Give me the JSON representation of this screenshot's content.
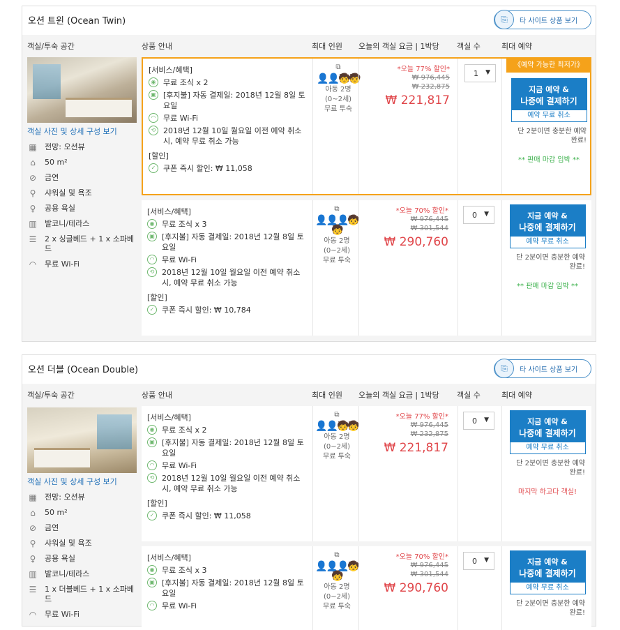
{
  "headers": {
    "room": "객실/투숙 공간",
    "product": "상품 안내",
    "occ": "최대 인원",
    "price": "오늘의 객실 요금 | 1박당",
    "qty": "객실 수",
    "book": "최대 예약"
  },
  "other_site": "타 사이트 상품 보기",
  "photo_link": "객실 사진 및 상세 구성 보기",
  "svc_head": "[서비스/혜택]",
  "disc_head": "[할인]",
  "occ_child": "아동 2명",
  "occ_age": "(0~2세)",
  "occ_free": "무료 투숙",
  "book_line1": "지금 예약 &",
  "book_line2": "나중에 결제하기",
  "free_cancel": "예약 무료 취소",
  "note": "단 2분이면 충분한 예약 완료!",
  "best_badge": "《예약 가능한 최저가》",
  "rooms": [
    {
      "title": "오션 트윈 (Ocean Twin)",
      "features": [
        "전망: 오션뷰",
        "50 m²",
        "금연",
        "샤워실 및 욕조",
        "공용 욕실",
        "발코니/테라스",
        "2 x 싱글베드 + 1 x 소파베드",
        "무료 Wi-Fi"
      ],
      "offers": [
        {
          "breakfast": "무료 조식 x 2",
          "pay": "[후지불] 자동 결제일: 2018년 12월 8일 토요일",
          "wifi": "무료 Wi-Fi",
          "cancel": "2018년 12월 10일 월요일 이전 예약 취소 시, 예약 무료 취소 가능",
          "coupon": "쿠폰 즉시 할인: ₩ 11,058",
          "disc": "*오늘 77% 할인*",
          "orig1": "₩ 976,445",
          "orig2": "₩ 232,875",
          "now": "₩ 221,817",
          "qty": "1",
          "alert": "** 판매 마감 임박 **",
          "alert_type": "green"
        },
        {
          "breakfast": "무료 조식 x 3",
          "pay": "[후지불] 자동 결제일: 2018년 12월 8일 토요일",
          "wifi": "무료 Wi-Fi",
          "cancel": "2018년 12월 10일 월요일 이전 예약 취소 시, 예약 무료 취소 가능",
          "coupon": "쿠폰 즉시 할인: ₩ 10,784",
          "disc": "*오늘 70% 할인*",
          "orig1": "₩ 976,445",
          "orig2": "₩ 301,544",
          "now": "₩ 290,760",
          "qty": "0",
          "alert": "** 판매 마감 임박 **",
          "alert_type": "green"
        }
      ]
    },
    {
      "title": "오션 더블 (Ocean Double)",
      "features": [
        "전망: 오션뷰",
        "50 m²",
        "금연",
        "샤워실 및 욕조",
        "공용 욕실",
        "발코니/테라스",
        "1 x 더블베드 + 1 x 소파베드",
        "무료 Wi-Fi"
      ],
      "offers": [
        {
          "breakfast": "무료 조식 x 2",
          "pay": "[후지불] 자동 결제일: 2018년 12월 8일 토요일",
          "wifi": "무료 Wi-Fi",
          "cancel": "2018년 12월 10일 월요일 이전 예약 취소 시, 예약 무료 취소 가능",
          "coupon": "쿠폰 즉시 할인: ₩ 11,058",
          "disc": "*오늘 77% 할인*",
          "orig1": "₩ 976,445",
          "orig2": "₩ 232,875",
          "now": "₩ 221,817",
          "qty": "0",
          "alert": "마지막 하고다 객실!",
          "alert_type": "red"
        },
        {
          "breakfast": "무료 조식 x 3",
          "pay": "[후지불] 자동 결제일: 2018년 12월 8일 토요일",
          "wifi": "무료 Wi-Fi",
          "cancel": "",
          "coupon": "",
          "disc": "*오늘 70% 할인*",
          "orig1": "₩ 976,445",
          "orig2": "₩ 301,544",
          "now": "₩ 290,760",
          "qty": "0",
          "alert": "",
          "alert_type": "none"
        }
      ]
    }
  ]
}
